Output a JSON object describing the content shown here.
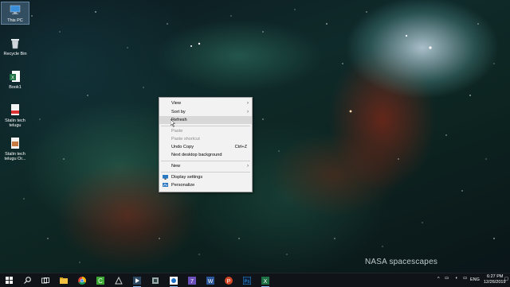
{
  "desktop": {
    "icons": [
      {
        "label": "This PC",
        "icon": "this-pc-icon",
        "selected": true
      },
      {
        "label": "Recycle Bin",
        "icon": "recycle-bin-icon"
      },
      {
        "label": "Book1",
        "icon": "excel-file-icon"
      },
      {
        "label": "Stalin tech telugu",
        "icon": "pdf-file-icon"
      },
      {
        "label": "Stalin tech telugu Or...",
        "icon": "image-file-icon"
      }
    ],
    "watermark": "NASA spacescapes"
  },
  "context_menu": {
    "items": [
      {
        "label": "View",
        "submenu": true
      },
      {
        "label": "Sort by",
        "submenu": true
      },
      {
        "label": "Refresh",
        "hovered": true
      },
      {
        "label": "Paste",
        "disabled": true
      },
      {
        "label": "Paste shortcut",
        "disabled": true
      },
      {
        "label": "Undo Copy",
        "shortcut": "Ctrl+Z"
      },
      {
        "label": "Next desktop background"
      },
      {
        "label": "New",
        "submenu": true
      },
      {
        "label": "Display settings",
        "icon": "display-settings-icon"
      },
      {
        "label": "Personalize",
        "icon": "personalize-icon"
      }
    ]
  },
  "taskbar": {
    "apps": [
      "start-icon",
      "search-icon",
      "task-view-icon",
      "file-explorer-icon",
      "chrome-icon",
      "camtasia-icon",
      "app-icon",
      "media-icon",
      "tool-icon",
      "screen-capture-icon",
      "calendar-icon",
      "word-icon",
      "powerpoint-icon",
      "photoshop-icon",
      "excel-icon"
    ],
    "tray": {
      "language": "ENG",
      "time": "6:27 PM",
      "date": "12/26/2019"
    }
  }
}
